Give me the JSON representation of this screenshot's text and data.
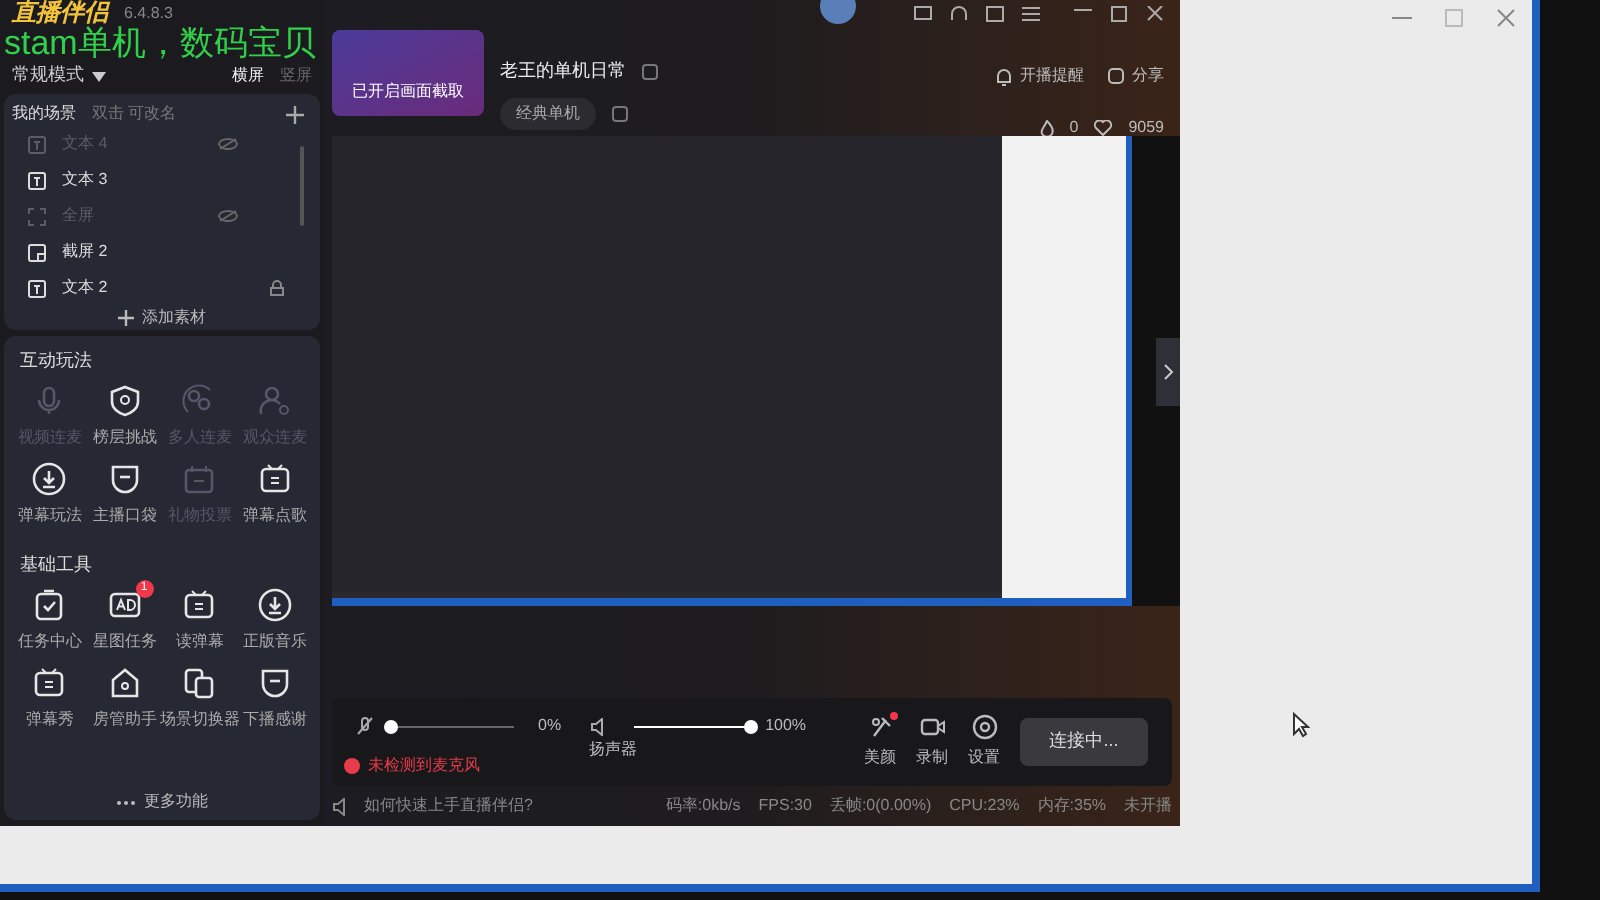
{
  "app": {
    "logo": "直播伴侣",
    "version": "6.4.8.3",
    "overlay_text": "stam单机，数码宝贝"
  },
  "mode": {
    "label": "常规模式",
    "orientations": [
      {
        "label": "横屏",
        "selected": true
      },
      {
        "label": "竖屏",
        "selected": false
      }
    ]
  },
  "scenes": {
    "title": "我的场景",
    "hint": "双击 可改名",
    "add_button": "添加素材",
    "items": [
      {
        "label": "文本 4",
        "kind": "text",
        "hidden": true,
        "locked": false
      },
      {
        "label": "文本 3",
        "kind": "text",
        "hidden": false,
        "locked": false
      },
      {
        "label": "全屏",
        "kind": "fullscreen",
        "hidden": true,
        "locked": false
      },
      {
        "label": "截屏 2",
        "kind": "screenshot",
        "hidden": false,
        "locked": false
      },
      {
        "label": "文本 2",
        "kind": "text",
        "hidden": false,
        "locked": true
      }
    ]
  },
  "interactive": {
    "title": "互动玩法",
    "items": [
      {
        "label": "视频连麦",
        "kind": "mic",
        "disabled": true
      },
      {
        "label": "榜层挑战",
        "kind": "shield",
        "disabled": false
      },
      {
        "label": "多人连麦",
        "kind": "multi",
        "disabled": true
      },
      {
        "label": "观众连麦",
        "kind": "person",
        "disabled": true
      },
      {
        "label": "弹幕玩法",
        "kind": "download",
        "disabled": false
      },
      {
        "label": "主播口袋",
        "kind": "pocket",
        "disabled": false
      },
      {
        "label": "礼物投票",
        "kind": "vote",
        "disabled": true
      },
      {
        "label": "弹幕点歌",
        "kind": "tv",
        "disabled": false
      }
    ]
  },
  "tools": {
    "title": "基础工具",
    "more": "更多功能",
    "items": [
      {
        "label": "任务中心",
        "kind": "clipboard"
      },
      {
        "label": "星图任务",
        "kind": "ad",
        "badge": "1"
      },
      {
        "label": "读弹幕",
        "kind": "tv"
      },
      {
        "label": "正版音乐",
        "kind": "download"
      },
      {
        "label": "弹幕秀",
        "kind": "tv"
      },
      {
        "label": "房管助手",
        "kind": "house"
      },
      {
        "label": "场景切换器",
        "kind": "copy"
      },
      {
        "label": "下播感谢",
        "kind": "pocket"
      }
    ]
  },
  "header": {
    "cover_caption": "已开启画面截取",
    "title": "老王的单机日常",
    "category": "经典单机",
    "remind": "开播提醒",
    "share": "分享",
    "fire_count": "0",
    "likes": "9059"
  },
  "audio": {
    "mic": {
      "muted": true,
      "level": 0,
      "reading": "0%"
    },
    "speaker": {
      "label": "扬声器",
      "level": 1,
      "reading": "100%"
    },
    "warning": "未检测到麦克风"
  },
  "actions": [
    {
      "label": "美颜",
      "kind": "beauty",
      "dot": true
    },
    {
      "label": "录制",
      "kind": "record",
      "dot": false
    },
    {
      "label": "设置",
      "kind": "settings",
      "dot": false
    }
  ],
  "connect_button": "连接中...",
  "status_bar": {
    "help": "如何快速上手直播伴侣?",
    "stats": [
      "码率:0kb/s",
      "FPS:30",
      "丢帧:0(0.00%)",
      "CPU:23%",
      "内存:35%",
      "未开播"
    ]
  }
}
